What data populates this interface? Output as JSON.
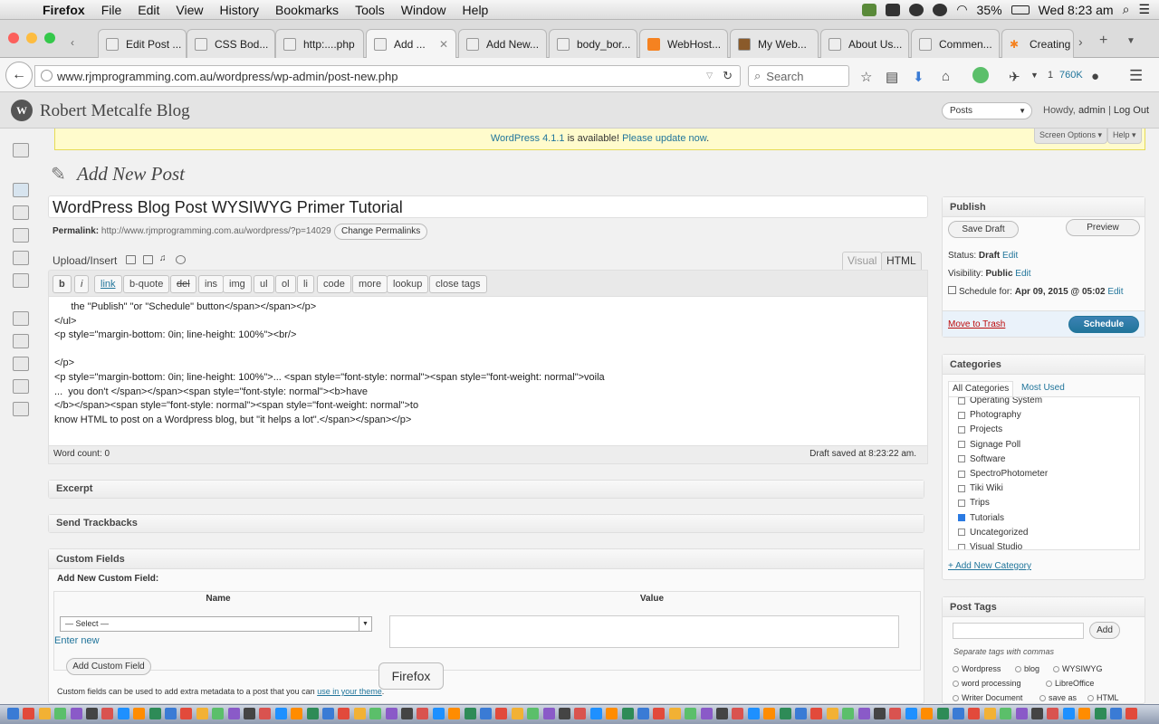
{
  "menubar": {
    "items": [
      "Firefox",
      "File",
      "Edit",
      "View",
      "History",
      "Bookmarks",
      "Tools",
      "Window",
      "Help"
    ],
    "battery": "35%",
    "clock": "Wed 8:23 am"
  },
  "tabs": [
    {
      "label": "Edit Post ..."
    },
    {
      "label": "CSS Bod..."
    },
    {
      "label": "http:....php"
    },
    {
      "label": "Add ...",
      "active": true
    },
    {
      "label": "Add New..."
    },
    {
      "label": "body_bor..."
    },
    {
      "label": "WebHost..."
    },
    {
      "label": "My Web..."
    },
    {
      "label": "About Us..."
    },
    {
      "label": "Commen..."
    },
    {
      "label": "Creating"
    }
  ],
  "nav": {
    "url": "www.rjmprogramming.com.au/wordpress/wp-admin/post-new.php",
    "search_placeholder": "Search",
    "ext_count": "1",
    "ext_size": "760K"
  },
  "wp": {
    "site_name": "Robert Metcalfe Blog",
    "favorites": "Posts",
    "howdy": "Howdy,",
    "user": "admin",
    "logout": "Log Out",
    "nag_link1": "WordPress 4.1.1",
    "nag_text": " is available! ",
    "nag_link2": "Please update now",
    "nag_end": ".",
    "screen_options": "Screen Options",
    "help": "Help"
  },
  "editor": {
    "page_title": "Add New Post",
    "post_title": "WordPress Blog Post WYSIWYG Primer Tutorial",
    "permalink_label": "Permalink:",
    "permalink_url": "http://www.rjmprogramming.com.au/wordpress/?p=14029",
    "change_permalinks": "Change Permalinks",
    "upload_insert": "Upload/Insert",
    "tab_visual": "Visual",
    "tab_html": "HTML",
    "quicktags": [
      "b",
      "i",
      "link",
      "b-quote",
      "del",
      "ins",
      "img",
      "ul",
      "ol",
      "li",
      "code",
      "more",
      "lookup",
      "close tags"
    ],
    "content": "      the \"Publish\" \"or \"Schedule\" button</span></span></p>\n</ul>\n<p style=\"margin-bottom: 0in; line-height: 100%\"><br/>\n\n</p>\n<p style=\"margin-bottom: 0in; line-height: 100%\">... <span style=\"font-style: normal\"><span style=\"font-weight: normal\">voila\n...  you don't </span></span><span style=\"font-style: normal\"><b>have\n</b></span><span style=\"font-style: normal\"><span style=\"font-weight: normal\">to\nknow HTML to post on a Wordpress blog, but \"it helps a lot\".</span></span></p>",
    "word_count": "Word count: 0",
    "draft_saved": "Draft saved at 8:23:22 am."
  },
  "boxes": {
    "excerpt": "Excerpt",
    "trackbacks": "Send Trackbacks",
    "custom_fields": "Custom Fields",
    "add_new_cf": "Add New Custom Field:",
    "col_name": "Name",
    "col_value": "Value",
    "select": "— Select —",
    "enter_new": "Enter new",
    "add_cf_button": "Add Custom Field",
    "cf_note": "Custom fields can be used to add extra metadata to a post that you can ",
    "cf_link": "use in your theme",
    "cf_end": "."
  },
  "publish": {
    "title": "Publish",
    "save_draft": "Save Draft",
    "preview": "Preview",
    "status_label": "Status:",
    "status": "Draft",
    "visibility_label": "Visibility:",
    "visibility": "Public",
    "schedule_label": "Schedule for:",
    "schedule": "Apr 09, 2015 @ 05:02",
    "edit": "Edit",
    "trash": "Move to Trash",
    "schedule_button": "Schedule"
  },
  "categories": {
    "title": "Categories",
    "tab_all": "All Categories",
    "tab_used": "Most Used",
    "items": [
      {
        "name": "Operating System",
        "checked": false
      },
      {
        "name": "Photography",
        "checked": false
      },
      {
        "name": "Projects",
        "checked": false
      },
      {
        "name": "Signage Poll",
        "checked": false
      },
      {
        "name": "Software",
        "checked": false
      },
      {
        "name": "SpectroPhotometer",
        "checked": false
      },
      {
        "name": "Tiki Wiki",
        "checked": false
      },
      {
        "name": "Trips",
        "checked": false
      },
      {
        "name": "Tutorials",
        "checked": true
      },
      {
        "name": "Uncategorized",
        "checked": false
      },
      {
        "name": "Visual Studio",
        "checked": false
      }
    ],
    "add_new": "+ Add New Category"
  },
  "tags": {
    "title": "Post Tags",
    "add": "Add",
    "hint": "Separate tags with commas",
    "items": [
      "Wordpress",
      "blog",
      "WYSIWYG",
      "word processing",
      "LibreOffice",
      "Writer Document",
      "save as",
      "HTML"
    ]
  },
  "tooltip": "Firefox"
}
